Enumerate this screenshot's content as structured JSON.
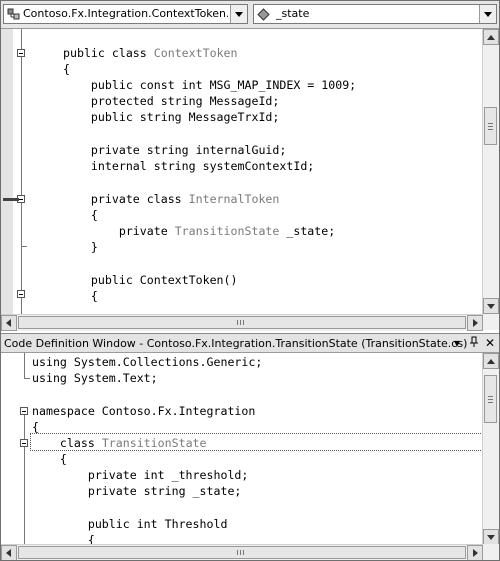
{
  "navbar": {
    "class_combo": {
      "text": "Contoso.Fx.Integration.ContextToken.Intern",
      "icon": "class-icon"
    },
    "member_combo": {
      "text": "_state",
      "icon": "field-icon"
    }
  },
  "editor": {
    "lines": [
      {
        "pre": "public class ",
        "type": "ContextToken",
        "post": ""
      },
      {
        "pre": "{",
        "type": "",
        "post": ""
      },
      {
        "pre": "    public const int MSG_MAP_INDEX = 1009;",
        "type": "",
        "post": ""
      },
      {
        "pre": "    protected string MessageId;",
        "type": "",
        "post": ""
      },
      {
        "pre": "    public string MessageTrxId;",
        "type": "",
        "post": ""
      },
      {
        "pre": "    private string internalGuid;",
        "type": "",
        "post": ""
      },
      {
        "pre": "    internal string systemContextId;",
        "type": "",
        "post": ""
      },
      {
        "pre": "    private class ",
        "type": "InternalToken",
        "post": ""
      },
      {
        "pre": "    {",
        "type": "",
        "post": ""
      },
      {
        "pre": "        private ",
        "type": "TransitionState",
        "post": " _state;"
      },
      {
        "pre": "    }",
        "type": "",
        "post": ""
      },
      {
        "pre": "    public ContextToken()",
        "type": "",
        "post": ""
      },
      {
        "pre": "    {",
        "type": "",
        "post": ""
      }
    ]
  },
  "cdw": {
    "title": "Code Definition Window - Contoso.Fx.Integration.TransitionState (TransitionState.cs)",
    "buttons": {
      "dropdown": "▾",
      "pin": "ᵖ",
      "close": "✕"
    },
    "lines": [
      {
        "pre": "using System.Collections.Generic;",
        "type": "",
        "post": ""
      },
      {
        "pre": "using System.Text;",
        "type": "",
        "post": ""
      },
      {
        "pre": "namespace Contoso.Fx.Integration",
        "type": "",
        "post": ""
      },
      {
        "pre": "{",
        "type": "",
        "post": ""
      },
      {
        "pre": "    class ",
        "type": "TransitionState",
        "post": ""
      },
      {
        "pre": "    {",
        "type": "",
        "post": ""
      },
      {
        "pre": "        private int _threshold;",
        "type": "",
        "post": ""
      },
      {
        "pre": "        private string _state;",
        "type": "",
        "post": ""
      },
      {
        "pre": "        public int Threshold",
        "type": "",
        "post": ""
      },
      {
        "pre": "        {",
        "type": "",
        "post": ""
      }
    ]
  }
}
